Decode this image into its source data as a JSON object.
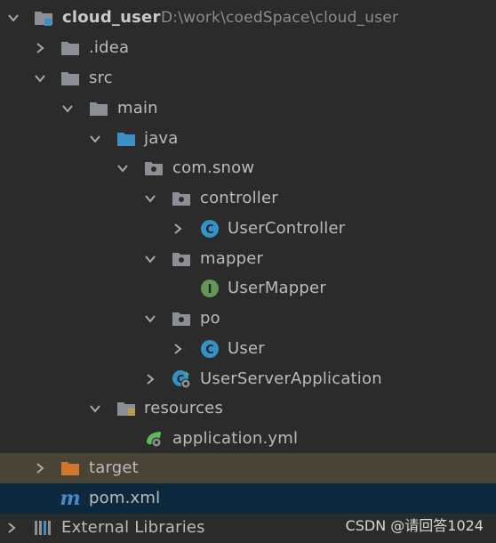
{
  "project": {
    "name": "cloud_user",
    "path": "D:\\work\\coedSpace\\cloud_user"
  },
  "tree": {
    "idea": ".idea",
    "src": "src",
    "main": "main",
    "java": "java",
    "com_snow": "com.snow",
    "controller": "controller",
    "user_controller": "UserController",
    "mapper": "mapper",
    "user_mapper": "UserMapper",
    "po": "po",
    "user": "User",
    "user_server_app": "UserServerApplication",
    "resources": "resources",
    "application_yml": "application.yml",
    "target": "target",
    "pom": "pom.xml",
    "external_libraries": "External Libraries"
  },
  "icons": {
    "class_letter": "C",
    "interface_letter": "I",
    "maven_letter": "m"
  },
  "colors": {
    "background": "#2b2b2b",
    "folder": "#8c9096",
    "source_folder": "#3d8ec9",
    "class_icon": "#3592c4",
    "interface_icon": "#629755",
    "target_folder": "#d0762f",
    "maven": "#4a88c7",
    "target_row_bg": "#4a4436",
    "selected_row_bg": "#0d293e"
  },
  "watermark": "CSDN @请回答1024"
}
